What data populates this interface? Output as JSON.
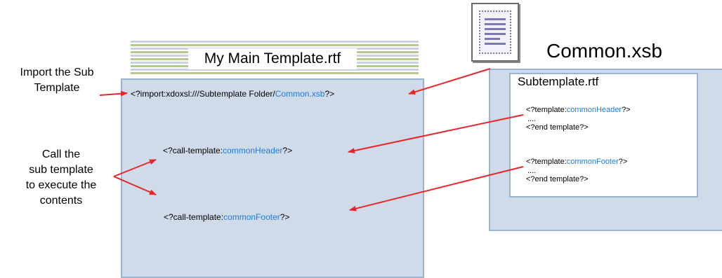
{
  "main": {
    "title": "My Main Template.rtf",
    "import_prefix": "<?import:xdoxsl:///Subtemplate Folder/",
    "import_file": "Common.xsb",
    "import_suffix": "?>",
    "call_header_prefix": "<?call-template:",
    "call_header_name": "commonHeader",
    "call_header_suffix": "?>",
    "call_footer_prefix": "<?call-template:",
    "call_footer_name": "commonFooter",
    "call_footer_suffix": "?>"
  },
  "common": {
    "title": "Common.xsb",
    "subtemplate_title": "Subtemplate.rtf",
    "header_prefix": "<?template:",
    "header_name": "commonHeader",
    "header_suffix": "?>",
    "ellipsis1": "....",
    "end1": "<?end template?>",
    "footer_prefix": "<?template:",
    "footer_name": "commonFooter",
    "footer_suffix": "?>",
    "ellipsis2": "....",
    "end2": "<?end template?>"
  },
  "labels": {
    "import_line1": "Import the Sub",
    "import_line2": "Template",
    "call_line1": "Call the",
    "call_line2": "sub template",
    "call_line3": "to execute the",
    "call_line4": "contents"
  },
  "colors": {
    "arrow": "#e8262a",
    "highlight": "#1f7ae0",
    "panel": "#cfdbe9"
  },
  "icons": {
    "document": "document-icon"
  }
}
